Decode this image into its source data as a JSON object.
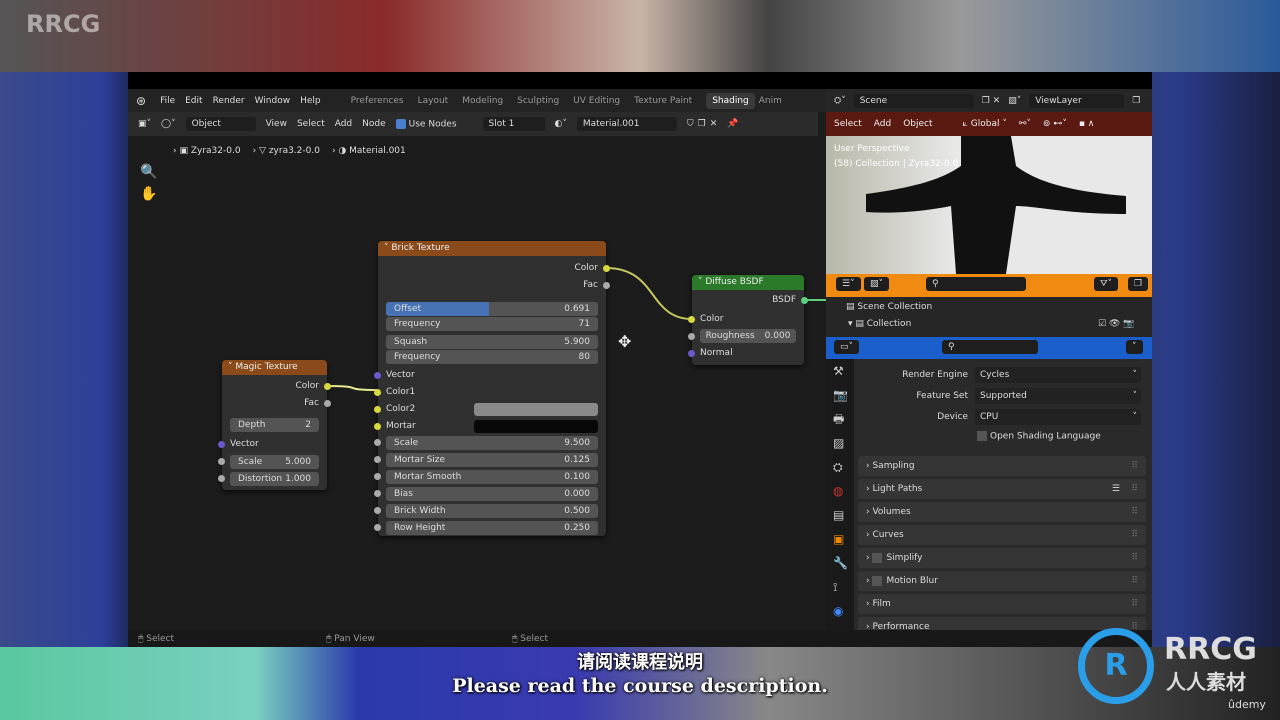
{
  "watermark": {
    "top_left": "RRCG",
    "logo_text": "RRCG",
    "logo_sub": "人人素材",
    "udemy": "ûdemy"
  },
  "subtitles": {
    "zh": "请阅读课程说明",
    "en": "Please read the course description."
  },
  "menu": {
    "items": [
      "File",
      "Edit",
      "Render",
      "Window",
      "Help"
    ],
    "workspaces": [
      "Preferences",
      "Layout",
      "Modeling",
      "Sculpting",
      "UV Editing",
      "Texture Paint",
      "Shading",
      "Anim"
    ],
    "active_workspace": "Shading"
  },
  "toolbar": {
    "mode": "Object",
    "items": [
      "View",
      "Select",
      "Add",
      "Node"
    ],
    "use_nodes": "Use Nodes",
    "use_nodes_checked": true,
    "slot": "Slot 1",
    "material": "Material.001"
  },
  "breadcrumb": [
    "Zyra32-0.0",
    "zyra3.2-0.0",
    "Material.001"
  ],
  "nodes": {
    "magic": {
      "title": "Magic Texture",
      "header_color": "#8a4a1a",
      "out_color": "Color",
      "out_fac": "Fac",
      "depth_label": "Depth",
      "depth": "2",
      "vector": "Vector",
      "scale_label": "Scale",
      "scale": "5.000",
      "distortion_label": "Distortion",
      "distortion": "1.000"
    },
    "brick": {
      "title": "Brick Texture",
      "header_color": "#8a4a1a",
      "out_color": "Color",
      "out_fac": "Fac",
      "offset_label": "Offset",
      "offset": "0.691",
      "offset_fill": 0.691,
      "freq1_label": "Frequency",
      "freq1": "71",
      "squash_label": "Squash",
      "squash": "5.900",
      "freq2_label": "Frequency",
      "freq2": "80",
      "vector": "Vector",
      "color1": "Color1",
      "color2": "Color2",
      "mortar": "Mortar",
      "color2_value": "#8a8a8a",
      "mortar_value": "#080808",
      "fields": [
        {
          "label": "Scale",
          "value": "9.500"
        },
        {
          "label": "Mortar Size",
          "value": "0.125"
        },
        {
          "label": "Mortar Smooth",
          "value": "0.100"
        },
        {
          "label": "Bias",
          "value": "0.000"
        },
        {
          "label": "Brick Width",
          "value": "0.500"
        },
        {
          "label": "Row Height",
          "value": "0.250"
        }
      ]
    },
    "diffuse": {
      "title": "Diffuse BSDF",
      "header_color": "#2a7a2a",
      "out": "BSDF",
      "color": "Color",
      "roughness_label": "Roughness",
      "roughness": "0.000",
      "normal": "Normal"
    }
  },
  "scene": {
    "scene": "Scene",
    "view_layer": "ViewLayer"
  },
  "viewport": {
    "menu": [
      "Select",
      "Add",
      "Object"
    ],
    "orientation": "Global",
    "overlay1": "User Perspective",
    "overlay2": "(58) Collection | Zyra32-0.0"
  },
  "outliner": {
    "scene_collection": "Scene Collection",
    "collection": "Collection"
  },
  "properties": {
    "render_engine_label": "Render Engine",
    "render_engine": "Cycles",
    "feature_set_label": "Feature Set",
    "feature_set": "Supported",
    "device_label": "Device",
    "device": "CPU",
    "osl": "Open Shading Language",
    "panels": [
      "Sampling",
      "Light Paths",
      "Volumes",
      "Curves",
      "Simplify",
      "Motion Blur",
      "Film",
      "Performance"
    ]
  },
  "status": {
    "left": "Select",
    "mid": "Pan View",
    "right": "Select"
  }
}
